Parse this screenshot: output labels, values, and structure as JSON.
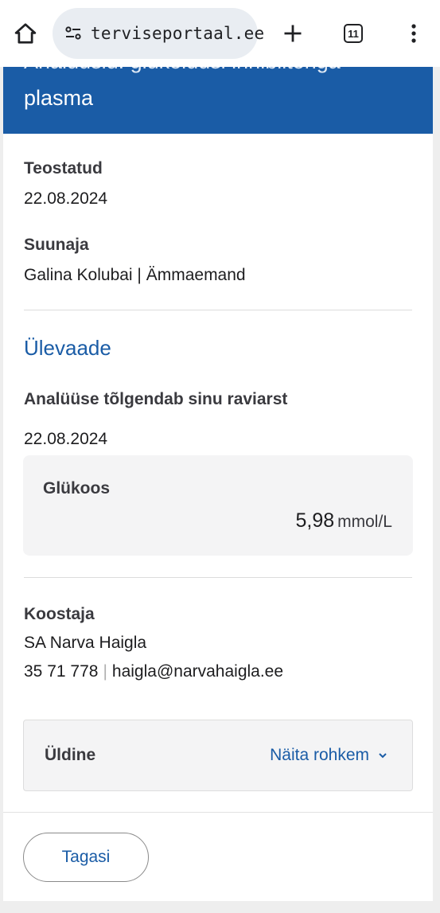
{
  "browser": {
    "url": "terviseportaal.ee",
    "tab_count": "11",
    "icons": {
      "home": "home-icon",
      "site_settings": "tune-icon",
      "new_tab": "plus-icon",
      "menu": "more-vertical-icon"
    }
  },
  "header": {
    "cut_text": "Analüüsid: glükolüüsi inhibiitoriga",
    "title": "plasma",
    "color": "#1a5ca6"
  },
  "details": {
    "performed_label": "Teostatud",
    "performed_value": "22.08.2024",
    "referrer_label": "Suunaja",
    "referrer_value": "Galina Kolubai | Ämmaemand"
  },
  "overview": {
    "title": "Ülevaade",
    "interpreter_label": "Analüüse tõlgendab sinu raviarst",
    "date": "22.08.2024",
    "result": {
      "name": "Glükoos",
      "value": "5,98",
      "unit": "mmol/L"
    }
  },
  "compiler": {
    "label": "Koostaja",
    "name": "SA Narva Haigla",
    "phone": "35 71 778",
    "separator": "|",
    "email": "haigla@narvahaigla.ee"
  },
  "general": {
    "label": "Üldine",
    "show_more": "Näita rohkem"
  },
  "footer": {
    "back_label": "Tagasi"
  }
}
